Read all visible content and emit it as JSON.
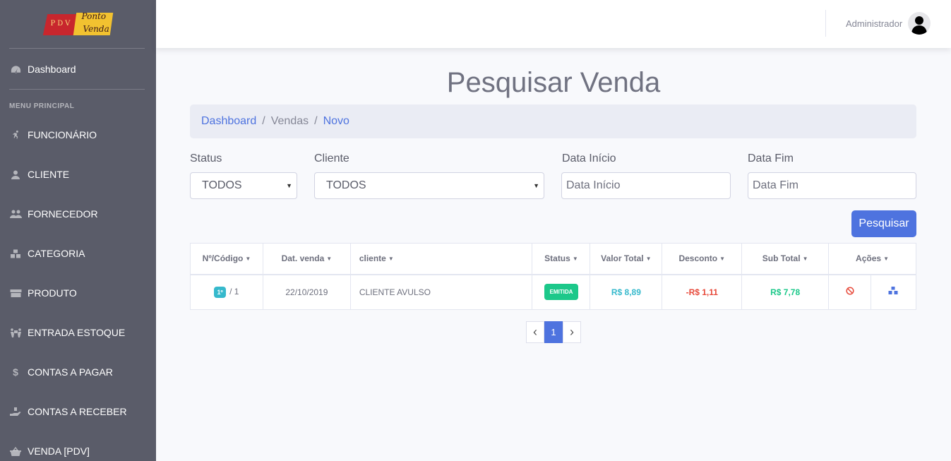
{
  "brand": {
    "logo_text_1": "PDV",
    "logo_text_2": "Ponto",
    "logo_text_3": "Venda"
  },
  "sidebar": {
    "dashboard": "Dashboard",
    "heading": "MENU PRINCIPAL",
    "items": [
      {
        "label": "FUNCIONÁRIO",
        "icon": "running-icon"
      },
      {
        "label": "CLIENTE",
        "icon": "user-icon"
      },
      {
        "label": "FORNECEDOR",
        "icon": "users-icon"
      },
      {
        "label": "CATEGORIA",
        "icon": "cubes-icon"
      },
      {
        "label": "PRODUTO",
        "icon": "box-icon"
      },
      {
        "label": "ENTRADA ESTOQUE",
        "icon": "people-carry-icon"
      },
      {
        "label": "CONTAS A PAGAR",
        "icon": "dollar-icon"
      },
      {
        "label": "CONTAS A RECEBER",
        "icon": "hand-holding-icon"
      },
      {
        "label": "VENDA [PDV]",
        "icon": "basket-icon"
      }
    ]
  },
  "topbar": {
    "user_name": "Administrador"
  },
  "page": {
    "title": "Pesquisar Venda"
  },
  "breadcrumb": {
    "home": "Dashboard",
    "section": "Vendas",
    "current": "Novo"
  },
  "filters": {
    "status_label": "Status",
    "status_value": "TODOS",
    "cliente_label": "Cliente",
    "cliente_value": "TODOS",
    "data_inicio_label": "Data Início",
    "data_inicio_placeholder": "Data Início",
    "data_fim_label": "Data Fim",
    "data_fim_placeholder": "Data Fim",
    "search_button": "Pesquisar"
  },
  "table": {
    "headers": [
      "Nº/Código",
      "Dat. venda",
      "cliente",
      "Status",
      "Valor Total",
      "Desconto",
      "Sub Total",
      "Ações"
    ],
    "rows": [
      {
        "num_tag": "1º",
        "codigo": "/ 1",
        "data": "22/10/2019",
        "cliente": "CLIENTE AVULSO",
        "status": "EMITIDA",
        "valor_total": "R$ 8,89",
        "desconto": "-R$ 1,11",
        "sub_total": "R$ 7,78"
      }
    ]
  },
  "pagination": {
    "prev": "‹",
    "current": "1",
    "next": "›"
  },
  "colors": {
    "sidebar": "#5a5c69",
    "primary": "#4e73df",
    "success": "#1cc88a",
    "info": "#36b9cc",
    "danger": "#e74a3b"
  }
}
